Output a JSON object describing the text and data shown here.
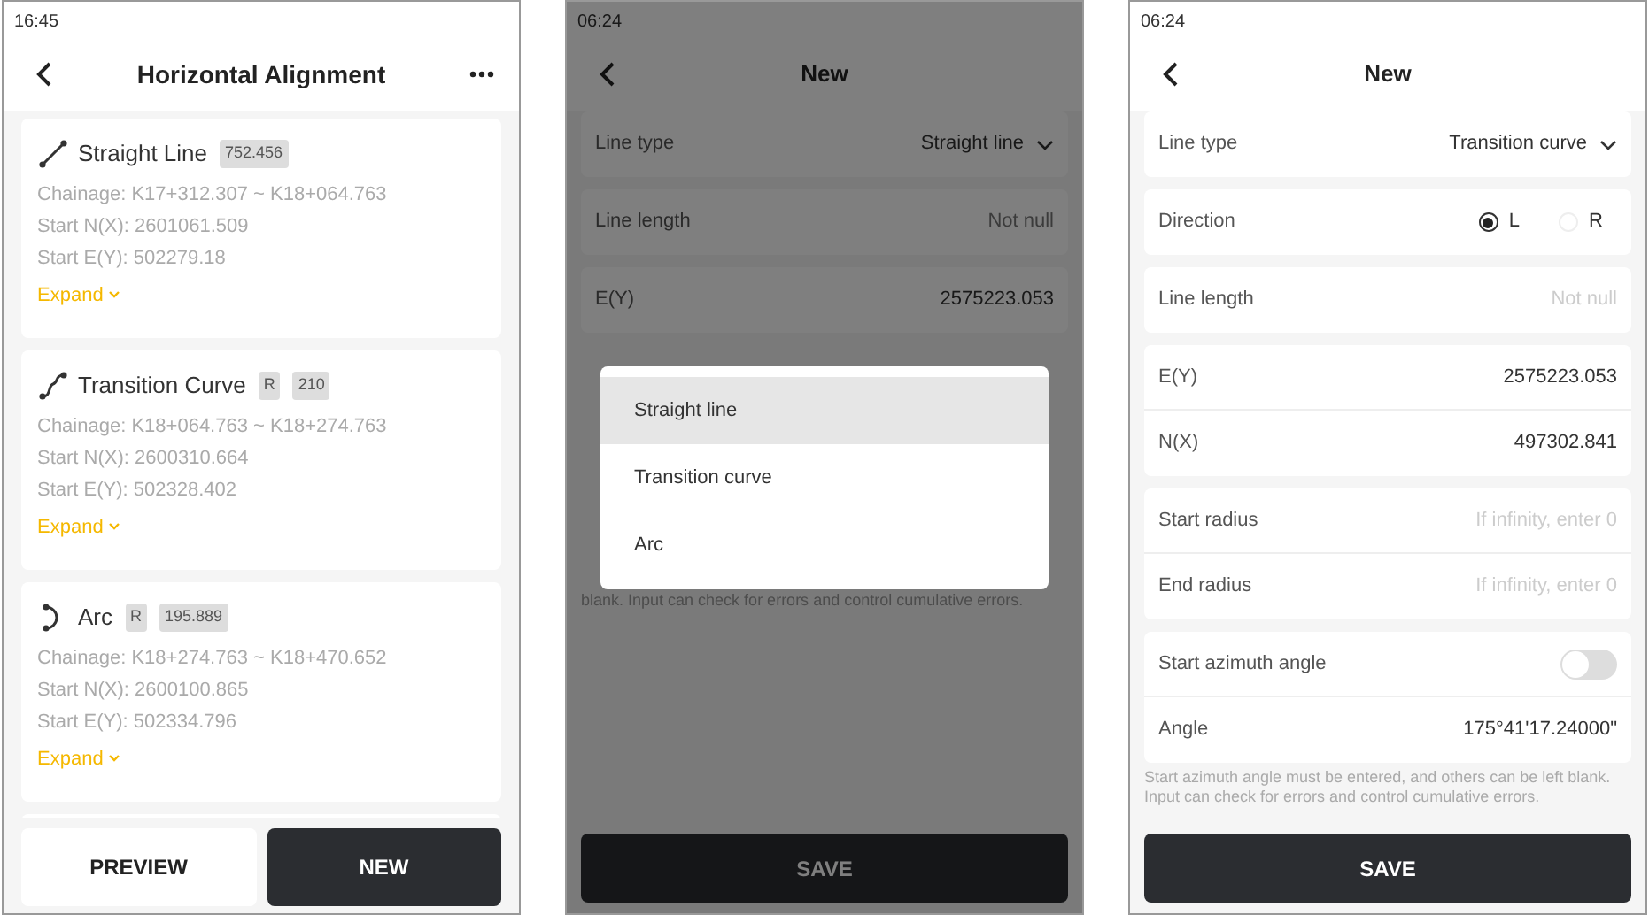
{
  "screens": [
    {
      "kind": "list",
      "status_time": "16:45",
      "title": "Horizontal Alignment",
      "items": [
        {
          "kind": "straight",
          "name": "Straight Line",
          "tags": [
            "752.456"
          ],
          "lines": [
            "Chainage: K17+312.307 ~ K18+064.763",
            "Start N(X): 2601061.509",
            "Start E(Y): 502279.18"
          ],
          "expand": "Expand"
        },
        {
          "kind": "transition",
          "name": "Transition Curve",
          "tags": [
            "R",
            "210"
          ],
          "lines": [
            "Chainage: K18+064.763 ~ K18+274.763",
            "Start N(X): 2600310.664",
            "Start E(Y): 502328.402"
          ],
          "expand": "Expand"
        },
        {
          "kind": "arc",
          "name": "Arc",
          "tags": [
            "R",
            "195.889"
          ],
          "lines": [
            "Chainage: K18+274.763 ~ K18+470.652",
            "Start N(X): 2600100.865",
            "Start E(Y): 502334.796"
          ],
          "expand": "Expand"
        }
      ],
      "buttons": [
        {
          "label": "PREVIEW",
          "primary": false
        },
        {
          "label": "NEW",
          "primary": true
        }
      ]
    },
    {
      "kind": "form",
      "status_time": "06:24",
      "title": "New",
      "groups": [
        [
          {
            "kind": "select",
            "label": "Line type",
            "value": "Straight line"
          }
        ],
        [
          {
            "kind": "input",
            "label": "Line length",
            "placeholder": "Not null"
          }
        ],
        [
          {
            "kind": "input",
            "label": "E(Y)",
            "value": "2575223.053"
          }
        ]
      ],
      "hint": "blank. Input can check for errors and control cumulative errors.",
      "save": "SAVE",
      "menu": {
        "options": [
          {
            "label": "Straight line",
            "selected": true
          },
          {
            "label": "Transition curve",
            "selected": false
          },
          {
            "label": "Arc",
            "selected": false
          }
        ]
      }
    },
    {
      "kind": "form",
      "status_time": "06:24",
      "title": "New",
      "groups": [
        [
          {
            "kind": "select",
            "label": "Line type",
            "value": "Transition curve"
          }
        ],
        [
          {
            "kind": "radio",
            "label": "Direction",
            "options": [
              {
                "label": "L",
                "selected": true
              },
              {
                "label": "R",
                "selected": false
              }
            ]
          }
        ],
        [
          {
            "kind": "input",
            "label": "Line length",
            "placeholder": "Not null"
          }
        ],
        [
          {
            "kind": "input",
            "label": "E(Y)",
            "value": "2575223.053"
          },
          {
            "kind": "input",
            "label": "N(X)",
            "value": "497302.841"
          }
        ],
        [
          {
            "kind": "input",
            "label": "Start radius",
            "placeholder": "If infinity, enter 0"
          },
          {
            "kind": "input",
            "label": "End radius",
            "placeholder": "If infinity, enter 0"
          }
        ],
        [
          {
            "kind": "toggle",
            "label": "Start azimuth angle",
            "on": false
          },
          {
            "kind": "input",
            "label": "Angle",
            "value": "175°41'17.24000\""
          }
        ]
      ],
      "hint": "Start azimuth angle must be entered, and others can be left blank. Input can check for errors and control cumulative errors.",
      "save": "SAVE"
    }
  ]
}
